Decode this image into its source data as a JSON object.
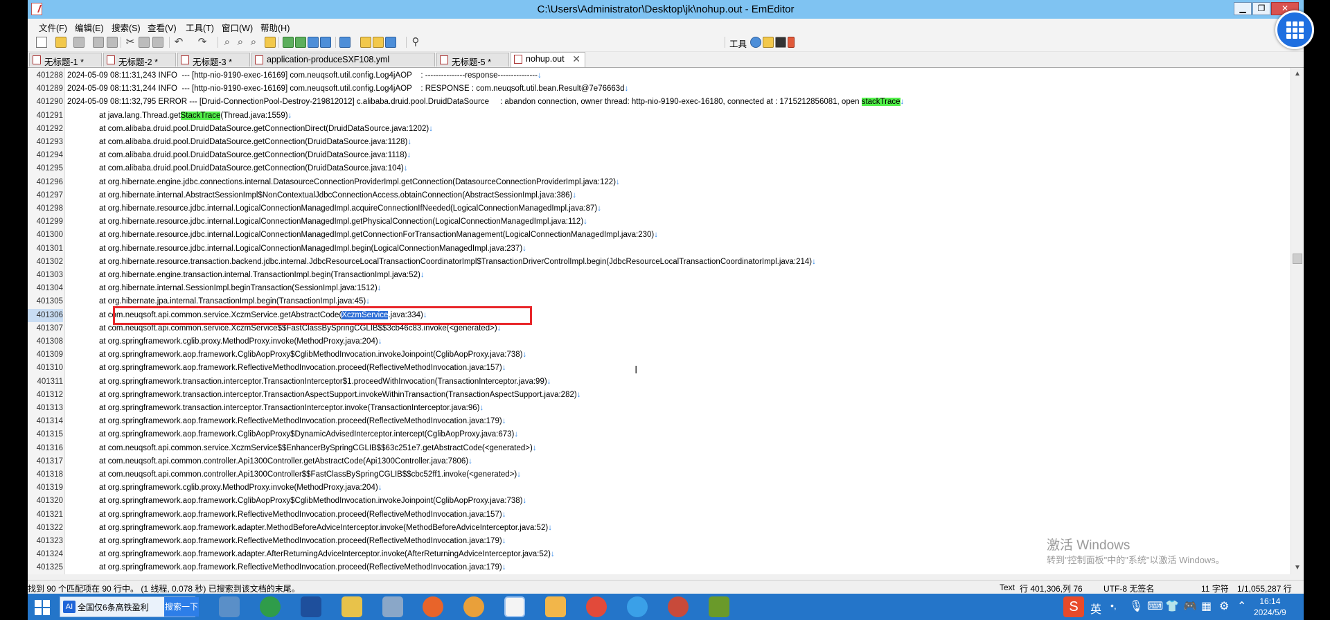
{
  "window": {
    "title": "C:\\Users\\Administrator\\Desktop\\jk\\nohup.out - EmEditor",
    "minimize": "▁",
    "restore": "❐",
    "close": "✕"
  },
  "menu": [
    "文件(F)",
    "编辑(E)",
    "搜索(S)",
    "查看(V)",
    "工具(T)",
    "窗口(W)",
    "帮助(H)"
  ],
  "toolbar": {
    "tools_label": "工具"
  },
  "tabs": [
    {
      "label": "无标题-1 *",
      "active": false
    },
    {
      "label": "无标题-2 *",
      "active": false
    },
    {
      "label": "无标题-3 *",
      "active": false
    },
    {
      "label": "application-produceSXF108.yml",
      "active": false
    },
    {
      "label": "无标题-5 *",
      "active": false
    },
    {
      "label": "nohup.out",
      "active": true,
      "close": "✕"
    }
  ],
  "editor": {
    "lf_mark": "↓",
    "lines": [
      {
        "num": "401288",
        "text": "2024-05-09 08:11:31,243 INFO  --- [http-nio-9190-exec-16169] com.neuqsoft.util.config.Log4jAOP    : ---------------response---------------"
      },
      {
        "num": "401289",
        "text": "2024-05-09 08:11:31,244 INFO  --- [http-nio-9190-exec-16169] com.neuqsoft.util.config.Log4jAOP    : RESPONSE : com.neuqsoft.util.bean.Result@7e76663d"
      },
      {
        "num": "401290",
        "text": "2024-05-09 08:11:32,795 ERROR --- [Druid-ConnectionPool-Destroy-219812012] c.alibaba.druid.pool.DruidDataSource     : abandon connection, owner thread: http-nio-9190-exec-16180, connected at : 1715212856081, open ",
        "hl": "stackTrace"
      },
      {
        "num": "401291",
        "text": "at java.lang.Thread.get",
        "hl": "StackTrace",
        "after": "(Thread.java:1559)"
      },
      {
        "num": "401292",
        "text": "at com.alibaba.druid.pool.DruidDataSource.getConnectionDirect(DruidDataSource.java:1202)"
      },
      {
        "num": "401293",
        "text": "at com.alibaba.druid.pool.DruidDataSource.getConnection(DruidDataSource.java:1128)"
      },
      {
        "num": "401294",
        "text": "at com.alibaba.druid.pool.DruidDataSource.getConnection(DruidDataSource.java:1118)"
      },
      {
        "num": "401295",
        "text": "at com.alibaba.druid.pool.DruidDataSource.getConnection(DruidDataSource.java:104)"
      },
      {
        "num": "401296",
        "text": "at org.hibernate.engine.jdbc.connections.internal.DatasourceConnectionProviderImpl.getConnection(DatasourceConnectionProviderImpl.java:122)"
      },
      {
        "num": "401297",
        "text": "at org.hibernate.internal.AbstractSessionImpl$NonContextualJdbcConnectionAccess.obtainConnection(AbstractSessionImpl.java:386)"
      },
      {
        "num": "401298",
        "text": "at org.hibernate.resource.jdbc.internal.LogicalConnectionManagedImpl.acquireConnectionIfNeeded(LogicalConnectionManagedImpl.java:87)"
      },
      {
        "num": "401299",
        "text": "at org.hibernate.resource.jdbc.internal.LogicalConnectionManagedImpl.getPhysicalConnection(LogicalConnectionManagedImpl.java:112)"
      },
      {
        "num": "401300",
        "text": "at org.hibernate.resource.jdbc.internal.LogicalConnectionManagedImpl.getConnectionForTransactionManagement(LogicalConnectionManagedImpl.java:230)"
      },
      {
        "num": "401301",
        "text": "at org.hibernate.resource.jdbc.internal.LogicalConnectionManagedImpl.begin(LogicalConnectionManagedImpl.java:237)"
      },
      {
        "num": "401302",
        "text": "at org.hibernate.resource.transaction.backend.jdbc.internal.JdbcResourceLocalTransactionCoordinatorImpl$TransactionDriverControlImpl.begin(JdbcResourceLocalTransactionCoordinatorImpl.java:214)"
      },
      {
        "num": "401303",
        "text": "at org.hibernate.engine.transaction.internal.TransactionImpl.begin(TransactionImpl.java:52)"
      },
      {
        "num": "401304",
        "text": "at org.hibernate.internal.SessionImpl.beginTransaction(SessionImpl.java:1512)"
      },
      {
        "num": "401305",
        "text": "at org.hibernate.jpa.internal.TransactionImpl.begin(TransactionImpl.java:45)"
      },
      {
        "num": "401306",
        "text": "at com.neuqsoft.api.common.service.XczmService.getAbstractCode(",
        "sel": "XczmService",
        "after": ".java:334)",
        "current": true
      },
      {
        "num": "401307",
        "text": "at com.neuqsoft.api.common.service.XczmService$$FastClassBySpringCGLIB$$3cb46c83.invoke(<generated>)"
      },
      {
        "num": "401308",
        "text": "at org.springframework.cglib.proxy.MethodProxy.invoke(MethodProxy.java:204)"
      },
      {
        "num": "401309",
        "text": "at org.springframework.aop.framework.CglibAopProxy$CglibMethodInvocation.invokeJoinpoint(CglibAopProxy.java:738)"
      },
      {
        "num": "401310",
        "text": "at org.springframework.aop.framework.ReflectiveMethodInvocation.proceed(ReflectiveMethodInvocation.java:157)"
      },
      {
        "num": "401311",
        "text": "at org.springframework.transaction.interceptor.TransactionInterceptor$1.proceedWithInvocation(TransactionInterceptor.java:99)"
      },
      {
        "num": "401312",
        "text": "at org.springframework.transaction.interceptor.TransactionAspectSupport.invokeWithinTransaction(TransactionAspectSupport.java:282)"
      },
      {
        "num": "401313",
        "text": "at org.springframework.transaction.interceptor.TransactionInterceptor.invoke(TransactionInterceptor.java:96)"
      },
      {
        "num": "401314",
        "text": "at org.springframework.aop.framework.ReflectiveMethodInvocation.proceed(ReflectiveMethodInvocation.java:179)"
      },
      {
        "num": "401315",
        "text": "at org.springframework.aop.framework.CglibAopProxy$DynamicAdvisedInterceptor.intercept(CglibAopProxy.java:673)"
      },
      {
        "num": "401316",
        "text": "at com.neuqsoft.api.common.service.XczmService$$EnhancerBySpringCGLIB$$63c251e7.getAbstractCode(<generated>)"
      },
      {
        "num": "401317",
        "text": "at com.neuqsoft.api.common.controller.Api1300Controller.getAbstractCode(Api1300Controller.java:7806)"
      },
      {
        "num": "401318",
        "text": "at com.neuqsoft.api.common.controller.Api1300Controller$$FastClassBySpringCGLIB$$cbc52ff1.invoke(<generated>)"
      },
      {
        "num": "401319",
        "text": "at org.springframework.cglib.proxy.MethodProxy.invoke(MethodProxy.java:204)"
      },
      {
        "num": "401320",
        "text": "at org.springframework.aop.framework.CglibAopProxy$CglibMethodInvocation.invokeJoinpoint(CglibAopProxy.java:738)"
      },
      {
        "num": "401321",
        "text": "at org.springframework.aop.framework.ReflectiveMethodInvocation.proceed(ReflectiveMethodInvocation.java:157)"
      },
      {
        "num": "401322",
        "text": "at org.springframework.aop.framework.adapter.MethodBeforeAdviceInterceptor.invoke(MethodBeforeAdviceInterceptor.java:52)"
      },
      {
        "num": "401323",
        "text": "at org.springframework.aop.framework.ReflectiveMethodInvocation.proceed(ReflectiveMethodInvocation.java:179)"
      },
      {
        "num": "401324",
        "text": "at org.springframework.aop.framework.adapter.AfterReturningAdviceInterceptor.invoke(AfterReturningAdviceInterceptor.java:52)"
      },
      {
        "num": "401325",
        "text": "at org.springframework.aop.framework.ReflectiveMethodInvocation.proceed(ReflectiveMethodInvocation.java:179)"
      }
    ]
  },
  "watermark": {
    "line1": "激活 Windows",
    "line2": "转到\"控制面板\"中的\"系统\"以激活 Windows。"
  },
  "status": {
    "search_result": "找到 90 个匹配项在 90 行中。 (1 线程, 0.078 秒) 已搜索到该文档的末尾。",
    "mode": "Text",
    "position": "行 401,306,列 76",
    "encoding": "UTF-8 无签名",
    "selection": "11 字符",
    "lines": "1/1,055,287 行"
  },
  "taskbar": {
    "search_app_label": "全国仅6条高铁盈利",
    "search_button": "搜索一下",
    "ime_label": "英",
    "time": "16:14",
    "date": "2024/5/9"
  },
  "colors": {
    "titlebar": "#7fc3f2",
    "taskbar": "#2475c9",
    "highlight": "#52f04a",
    "selection": "#2f6fd6",
    "annotation_box": "#e8262a"
  }
}
